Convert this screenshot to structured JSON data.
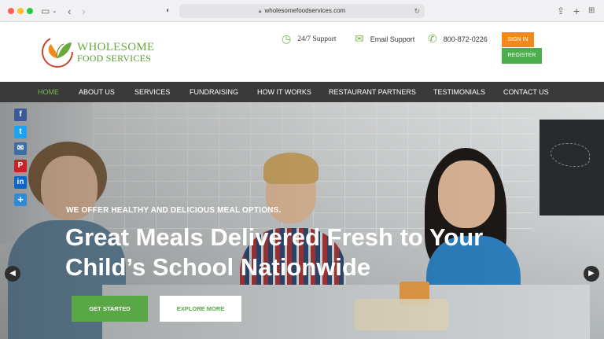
{
  "browser": {
    "url": "wholesomefoodservices.com"
  },
  "header": {
    "logo_line1": "WHOLESOME",
    "logo_line2": "FOOD SERVICES",
    "support_label": "24/7 Support",
    "email_label": "Email Support",
    "phone": "800-872-0226",
    "signin_label": "SIGN IN",
    "register_label": "REGISTER"
  },
  "nav": {
    "items": [
      "HOME",
      "ABOUT US",
      "SERVICES",
      "FUNDRAISING",
      "HOW IT WORKS",
      "RESTAURANT PARTNERS",
      "TESTIMONIALS",
      "CONTACT US"
    ],
    "active": "HOME"
  },
  "hero": {
    "tagline": "WE OFFER HEALTHY AND DELICIOUS MEAL OPTIONS.",
    "headline": "Great Meals Delivered Fresh to Your Child’s School Nationwide",
    "primary_button": "GET STARTED",
    "secondary_button": "EXPLORE MORE"
  },
  "social": {
    "icons": [
      "facebook-icon",
      "twitter-icon",
      "email-icon",
      "pinterest-icon",
      "linkedin-icon",
      "share-icon"
    ]
  },
  "colors": {
    "brand_green": "#5aa845",
    "accent_orange": "#f08a1d",
    "nav_bg": "#3a3a3a"
  }
}
